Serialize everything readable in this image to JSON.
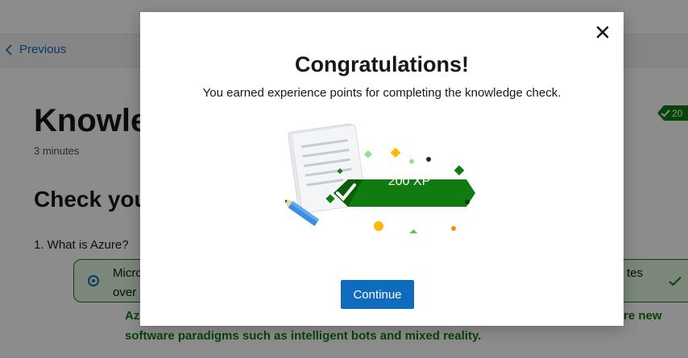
{
  "nav": {
    "previous_label": "Previous"
  },
  "unit": {
    "title": "Knowle",
    "duration": "3 minutes",
    "xp_badge": "20",
    "section_title": "Check you",
    "question": "1. What is Azure?",
    "answer_line1": "Micro",
    "answer_line2": "over",
    "answer_right": "tes",
    "explanation_line1": "Az",
    "explanation_right": "re new",
    "explanation_line2": "software paradigms such as intelligent bots and mixed reality."
  },
  "modal": {
    "title": "Congratulations!",
    "subtitle": "You earned experience points for completing the knowledge check.",
    "xp_text": "200 XP",
    "continue_label": "Continue"
  },
  "colors": {
    "accent_blue": "#0f6cbd",
    "success_green": "#107c10",
    "overlay": "rgba(0,0,0,0.45)"
  },
  "icons": {
    "close": "close-icon",
    "previous": "chevron-left-icon",
    "check": "checkmark-icon"
  }
}
